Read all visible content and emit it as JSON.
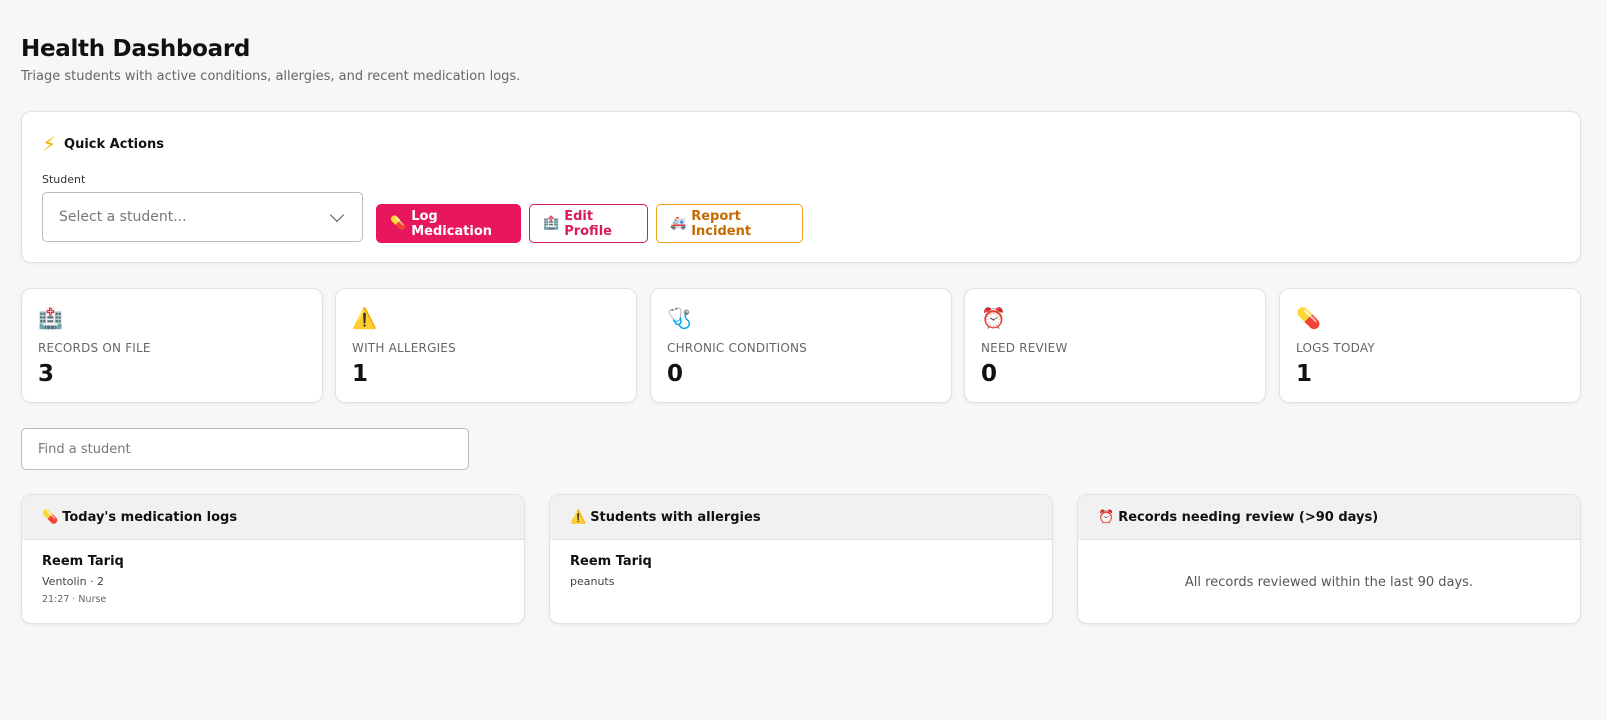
{
  "header": {
    "title": "Health Dashboard",
    "subtitle": "Triage students with active conditions, allergies, and recent medication logs."
  },
  "quick_actions": {
    "icon": "⚡",
    "title": "Quick Actions",
    "student_label": "Student",
    "student_select_value": "Select a student...",
    "buttons": {
      "log": {
        "icon": "💊",
        "label": "Log Medication"
      },
      "edit": {
        "icon": "🏥",
        "label": "Edit Profile"
      },
      "report": {
        "icon": "🚑",
        "label": "Report Incident"
      }
    }
  },
  "stats": [
    {
      "icon": "🏥",
      "label": "RECORDS ON FILE",
      "value": "3"
    },
    {
      "icon": "⚠️",
      "label": "WITH ALLERGIES",
      "value": "1"
    },
    {
      "icon": "🩺",
      "label": "CHRONIC CONDITIONS",
      "value": "0"
    },
    {
      "icon": "⏰",
      "label": "NEED REVIEW",
      "value": "0"
    },
    {
      "icon": "💊",
      "label": "LOGS TODAY",
      "value": "1"
    }
  ],
  "search": {
    "placeholder": "Find a student"
  },
  "panels": {
    "medication_logs": {
      "icon": "💊",
      "title": "Today's medication logs",
      "items": [
        {
          "name": "Reem Tariq",
          "detail": "Ventolin · 2",
          "meta": "21:27 · Nurse"
        }
      ]
    },
    "allergies": {
      "icon": "⚠️",
      "title": "Students with allergies",
      "items": [
        {
          "name": "Reem Tariq",
          "detail": "peanuts"
        }
      ]
    },
    "review": {
      "icon": "⏰",
      "title": "Records needing review (>90 days)",
      "empty_text": "All records reviewed within the last 90 days."
    }
  },
  "colors": {
    "primary": "#e8175d",
    "edit_border": "#d81b60",
    "report_border": "#f0a020",
    "background": "#f7f7f7"
  }
}
